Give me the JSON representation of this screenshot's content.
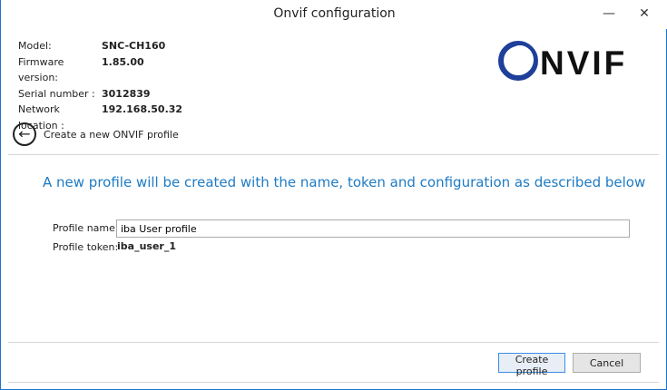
{
  "window": {
    "title": "Onvif configuration",
    "minimize": "—",
    "close": "✕"
  },
  "device": {
    "model_label": "Model:",
    "model": "SNC-CH160",
    "firmware_label": "Firmware version:",
    "firmware": "1.85.00",
    "serial_label": "Serial number :",
    "serial": "3012839",
    "network_label": "Network location :",
    "network": "192.168.50.32"
  },
  "logo": {
    "text": "ONVIF",
    "accent": "#1e3f9a"
  },
  "nav": {
    "back_label": "Create a new ONVIF profile"
  },
  "main": {
    "heading": "A new profile will be created with the name, token and configuration as described below",
    "profile_name_label": "Profile name :",
    "profile_name_value": "iba User profile",
    "profile_token_label": "Profile token:",
    "profile_token_value": "iba_user_1"
  },
  "footer": {
    "create_label": "Create profile",
    "cancel_label": "Cancel"
  }
}
